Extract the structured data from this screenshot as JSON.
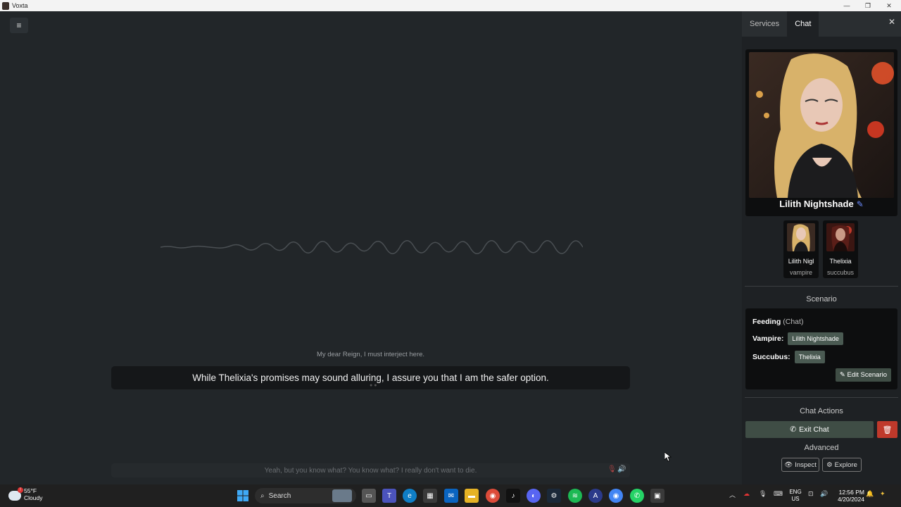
{
  "window": {
    "title": "Voxta"
  },
  "main": {
    "previous_message": "My dear Reign, I must interject here.",
    "current_message": "While Thelixia's promises may sound alluring, I assure you that I am the safer option.",
    "input_text": "Yeah, but you know what? You know what? I really don't want to die."
  },
  "sidebar": {
    "tabs": [
      {
        "label": "Services"
      },
      {
        "label": "Chat"
      }
    ],
    "active_tab": "Chat",
    "character": {
      "name": "Lilith Nightshade"
    },
    "characters": [
      {
        "name": "Lilith Nigl",
        "role": "vampire"
      },
      {
        "name": "Thelixia",
        "role": "succubus"
      }
    ],
    "scenario_title": "Scenario",
    "scenario": {
      "name": "Feeding",
      "type": "(Chat)",
      "roles": [
        {
          "role": "Vampire:",
          "value": "Lilith Nightshade"
        },
        {
          "role": "Succubus:",
          "value": "Thelixia"
        }
      ],
      "edit_label": "Edit Scenario"
    },
    "chat_actions_title": "Chat Actions",
    "exit_chat_label": "Exit Chat",
    "advanced_title": "Advanced",
    "inspect_label": "Inspect",
    "explore_label": "Explore"
  },
  "taskbar": {
    "weather_temp": "55°F",
    "weather_desc": "Cloudy",
    "search_label": "Search",
    "lang_top": "ENG",
    "lang_bottom": "US",
    "time": "12:56 PM",
    "date": "4/20/2024"
  },
  "colors": {
    "accent_button": "#3f4d45",
    "danger": "#c0392b",
    "edit_pencil": "#6c8cff"
  }
}
